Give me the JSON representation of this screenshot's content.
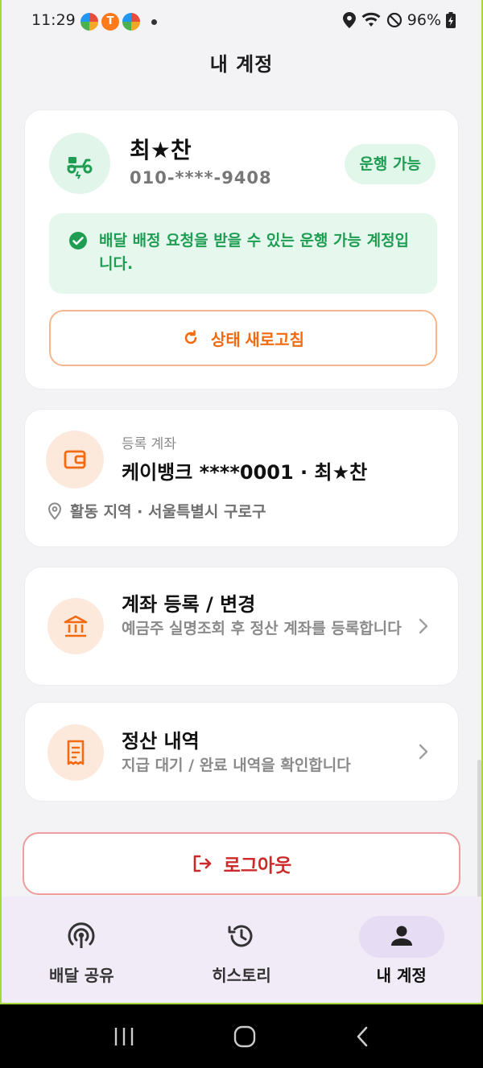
{
  "status_bar": {
    "time": "11:29",
    "notif_badge": "T",
    "battery": "96%"
  },
  "header": {
    "title": "내 계정"
  },
  "driver": {
    "name": "최★찬",
    "phone": "010-****-9408",
    "status_pill": "운행 가능",
    "notice": "배달 배정 요청을 받을 수 있는 운행 가능 계정입니다.",
    "refresh_label": "상태 새로고침",
    "accent_green": "#1f9d52",
    "accent_orange": "#f36a10"
  },
  "account": {
    "label": "등록 계좌",
    "value": "케이뱅크 ****0001 · 최★찬",
    "region": "활동 지역 · 서울특별시 구로구"
  },
  "menu": {
    "bank": {
      "title": "계좌 등록 / 변경",
      "desc": "예금주 실명조회 후 정산 계좌를 등록합니다"
    },
    "settle": {
      "title": "정산 내역",
      "desc": "지급 대기 / 완료 내역을 확인합니다"
    }
  },
  "logout": {
    "label": "로그아웃",
    "color": "#cc2a2a"
  },
  "bottom_nav": {
    "items": [
      {
        "label": "배달 공유",
        "icon": "broadcast-icon"
      },
      {
        "label": "히스토리",
        "icon": "history-icon"
      },
      {
        "label": "내 계정",
        "icon": "person-icon",
        "active": true
      }
    ]
  }
}
